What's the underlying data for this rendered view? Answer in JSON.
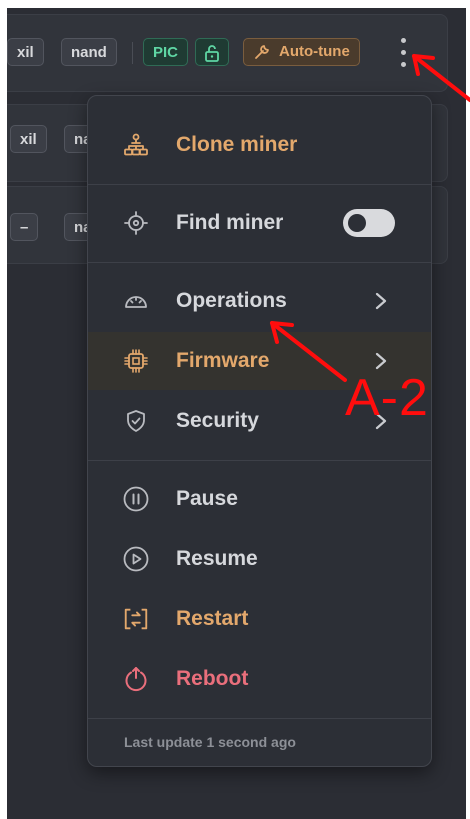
{
  "rows": [
    {
      "chips": [
        "xil",
        "nand"
      ],
      "badges": {
        "pic": "PIC",
        "autotune": "Auto-tune"
      }
    },
    {
      "chips": [
        "xil",
        "na"
      ]
    },
    {
      "chips": [
        "–",
        "na"
      ]
    }
  ],
  "menu": {
    "clone": {
      "label": "Clone miner",
      "icon": "cloner-icon"
    },
    "find": {
      "label": "Find miner",
      "icon": "target-icon",
      "toggle_on": false
    },
    "operations": {
      "label": "Operations",
      "icon": "gauge-icon"
    },
    "firmware": {
      "label": "Firmware",
      "icon": "chip-icon"
    },
    "security": {
      "label": "Security",
      "icon": "shield-check-icon"
    },
    "pause": {
      "label": "Pause",
      "icon": "pause-icon"
    },
    "resume": {
      "label": "Resume",
      "icon": "play-icon"
    },
    "restart": {
      "label": "Restart",
      "icon": "restart-icon"
    },
    "reboot": {
      "label": "Reboot",
      "icon": "power-icon"
    },
    "footer": "Last update 1 second ago"
  },
  "annotation": {
    "label": "A-2"
  },
  "colors": {
    "accent": "#e3a86c",
    "danger": "#ea6f7c",
    "success": "#5fd6a4",
    "annotation": "#ff0d0d"
  }
}
